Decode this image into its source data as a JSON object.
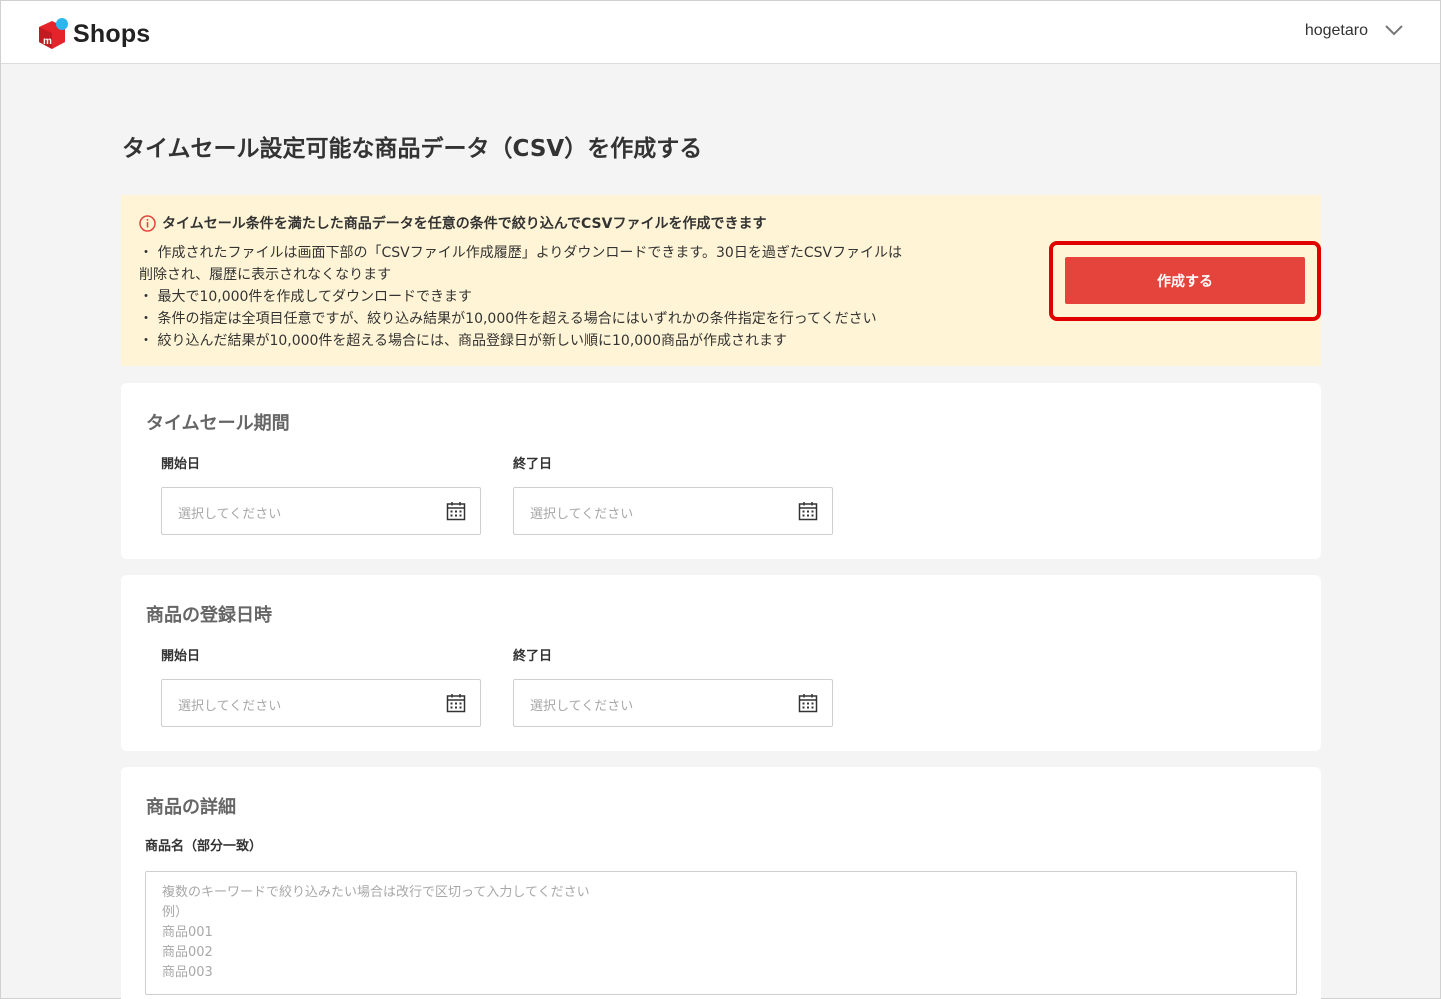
{
  "header": {
    "brand": "Shops",
    "username": "hogetaro",
    "brand_colors": {
      "red": "#e4232a",
      "blue": "#2fb5ee"
    }
  },
  "page": {
    "title": "タイムセール設定可能な商品データ（CSV）を作成する"
  },
  "notice": {
    "headline": "タイムセール条件を満たした商品データを任意の条件で絞り込んでCSVファイルを作成できます",
    "lines": [
      "・ 作成されたファイルは画面下部の「CSVファイル作成履歴」よりダウンロードできます。30日を過ぎたCSVファイルは",
      "削除され、履歴に表示されなくなります",
      "・ 最大で10,000件を作成してダウンロードできます",
      "・ 条件の指定は全項目任意ですが、絞り込み結果が10,000件を超える場合にはいずれかの条件指定を行ってください",
      "・ 絞り込んだ結果が10,000件を超える場合には、商品登録日が新しい順に10,000商品が作成されます"
    ],
    "create_button": "作成する",
    "accent_color": "#e4443c",
    "background_color": "#fff5d6"
  },
  "timesale_period": {
    "title": "タイムセール期間",
    "start_label": "開始日",
    "start_placeholder": "選択してください",
    "end_label": "終了日",
    "end_placeholder": "選択してください"
  },
  "registration_date": {
    "title": "商品の登録日時",
    "start_label": "開始日",
    "start_placeholder": "選択してください",
    "end_label": "終了日",
    "end_placeholder": "選択してください"
  },
  "product_details": {
    "title": "商品の詳細",
    "name_label": "商品名（部分一致）",
    "name_placeholder_lines": [
      "複数のキーワードで絞り込みたい場合は改行で区切って入力してください",
      "例）",
      "商品001",
      "商品002",
      "商品003"
    ]
  }
}
